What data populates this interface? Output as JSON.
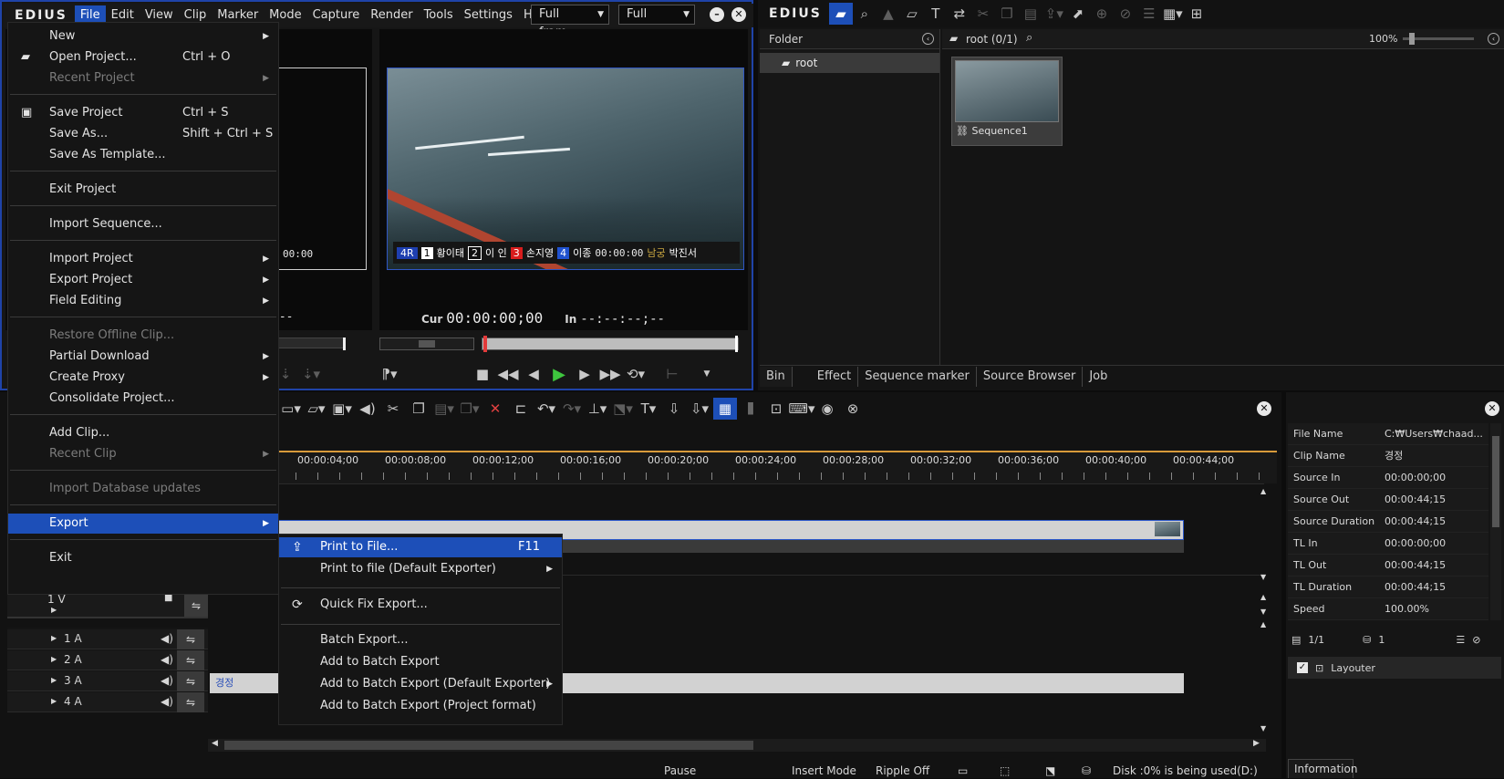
{
  "app": {
    "logo": "EDIUS"
  },
  "menubar": {
    "items": [
      "File",
      "Edit",
      "View",
      "Clip",
      "Marker",
      "Mode",
      "Capture",
      "Render",
      "Tools",
      "Settings",
      "Help"
    ],
    "active": "File",
    "combo1": "Full fram...",
    "combo2": "Full"
  },
  "player": {
    "left_timecode": "00:00",
    "left_in": ";--",
    "cur_label": "Cur",
    "cur_value": "00:00:00;00",
    "in_label": "In",
    "in_value": "--:--:--;--",
    "overlay": {
      "race": "4R",
      "r1": "황이태",
      "r2": "이 인",
      "r3": "손지영",
      "r4": "이종",
      "r5": "남궁",
      "r6": "박진서",
      "time": "00:00:00"
    }
  },
  "file_menu": {
    "items": [
      {
        "label": "New",
        "submenu": true
      },
      {
        "label": "Open Project...",
        "shortcut": "Ctrl + O",
        "icon": "folder-open-icon"
      },
      {
        "label": "Recent Project",
        "submenu": true,
        "disabled": true
      },
      {
        "label": "Save Project",
        "shortcut": "Ctrl + S",
        "icon": "floppy-icon"
      },
      {
        "label": "Save As...",
        "shortcut": "Shift + Ctrl + S"
      },
      {
        "label": "Save As Template..."
      },
      {
        "label": "Exit Project"
      },
      {
        "label": "Import Sequence..."
      },
      {
        "label": "Import Project",
        "submenu": true
      },
      {
        "label": "Export Project",
        "submenu": true
      },
      {
        "label": "Field Editing",
        "submenu": true
      },
      {
        "label": "Restore Offline Clip...",
        "disabled": true
      },
      {
        "label": "Partial Download",
        "submenu": true
      },
      {
        "label": "Create Proxy",
        "submenu": true
      },
      {
        "label": "Consolidate Project..."
      },
      {
        "label": "Add Clip..."
      },
      {
        "label": "Recent Clip",
        "submenu": true,
        "disabled": true
      },
      {
        "label": "Import Database updates",
        "disabled": true
      },
      {
        "label": "Export",
        "submenu": true,
        "selected": true
      },
      {
        "label": "Exit"
      }
    ]
  },
  "export_menu": {
    "items": [
      {
        "label": "Print to File...",
        "shortcut": "F11",
        "selected": true,
        "icon": "export-icon"
      },
      {
        "label": "Print to file (Default Exporter)",
        "submenu": true
      },
      {
        "label": "Quick Fix Export...",
        "icon": "quick-fix-icon"
      },
      {
        "label": "Batch Export..."
      },
      {
        "label": "Add to Batch Export"
      },
      {
        "label": "Add to Batch Export (Default Exporter)",
        "submenu": true
      },
      {
        "label": "Add to Batch Export (Project format)"
      }
    ]
  },
  "bin": {
    "logo": "EDIUS",
    "folder_header": "Folder",
    "root_folder": "root",
    "path": "root (0/1)",
    "zoom": "100%",
    "clip_name": "Sequence1",
    "tabs": [
      "Bin",
      "Effect",
      "Sequence marker",
      "Source Browser",
      "Job"
    ],
    "active_tab": "Bin"
  },
  "timeline": {
    "ruler": [
      "00:00:04;00",
      "00:00:08;00",
      "00:00:12;00",
      "00:00:16;00",
      "00:00:20;00",
      "00:00:24;00",
      "00:00:28;00",
      "00:00:32;00",
      "00:00:36;00",
      "00:00:40;00",
      "00:00:44;00"
    ],
    "video_track": "1 V",
    "audio_tracks": [
      "1 A",
      "2 A",
      "3 A",
      "4 A"
    ],
    "audio_clip": "경정"
  },
  "info": {
    "rows": [
      {
        "k": "File Name",
        "v": "C:₩Users₩chaad..."
      },
      {
        "k": "Clip Name",
        "v": "경정"
      },
      {
        "k": "Source In",
        "v": "00:00:00;00"
      },
      {
        "k": "Source Out",
        "v": "00:00:44;15"
      },
      {
        "k": "Source Duration",
        "v": "00:00:44;15"
      },
      {
        "k": "TL In",
        "v": "00:00:00;00"
      },
      {
        "k": "TL Out",
        "v": "00:00:44;15"
      },
      {
        "k": "TL Duration",
        "v": "00:00:44;15"
      },
      {
        "k": "Speed",
        "v": "100.00%"
      }
    ],
    "page": "1/1",
    "count": "1",
    "layer": "Layouter",
    "tab": "Information"
  },
  "status": {
    "pause": "Pause",
    "insert": "Insert Mode",
    "ripple": "Ripple Off",
    "disk": "Disk :0% is being used(D:)"
  }
}
